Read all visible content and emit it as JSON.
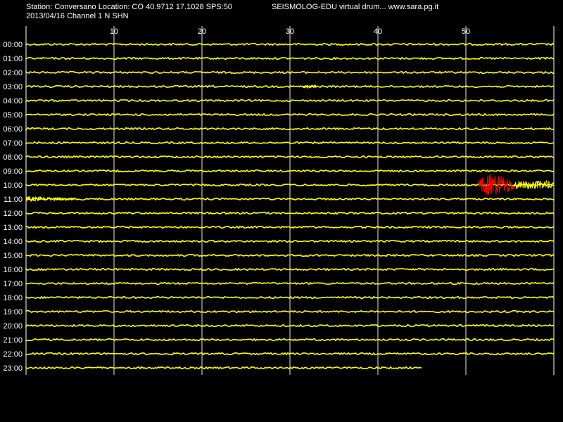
{
  "header": {
    "station": "Station: Conversano Location: CO 40.9712 17.1028 SPS:50",
    "app": "SEISMOLOG-EDU virtual drum... www.sara.pg.it",
    "date_channel": "2013/04/16  Channel 1 N SHN"
  },
  "colors": {
    "background": "#000000",
    "trace": "#ffff00",
    "event": "#ff0000",
    "grid": "#ffffff",
    "text": "#ffffff"
  },
  "axis": {
    "minute_ticks": [
      "10",
      "20",
      "30",
      "40",
      "50"
    ],
    "minutes_per_line": 60
  },
  "hours": [
    "00:00",
    "01:00",
    "02:00",
    "03:00",
    "04:00",
    "05:00",
    "06:00",
    "07:00",
    "08:00",
    "09:00",
    "10:00",
    "11:00",
    "12:00",
    "13:00",
    "14:00",
    "15:00",
    "16:00",
    "17:00",
    "18:00",
    "19:00",
    "20:00",
    "21:00",
    "22:00",
    "23:00"
  ],
  "recording": {
    "last_line_end_minute": 45,
    "events": [
      {
        "hour": "03:00",
        "start_minute": 31.5,
        "end_minute": 33,
        "kind": "small",
        "color": "yellow"
      },
      {
        "hour": "10:00",
        "start_minute": 51.5,
        "end_minute": 55.5,
        "kind": "main",
        "color": "red"
      },
      {
        "hour": "10:00",
        "start_minute": 55.5,
        "end_minute": 60,
        "kind": "coda",
        "color": "yellow"
      },
      {
        "hour": "11:00",
        "start_minute": 0,
        "end_minute": 5.5,
        "kind": "coda",
        "color": "yellow"
      }
    ]
  }
}
